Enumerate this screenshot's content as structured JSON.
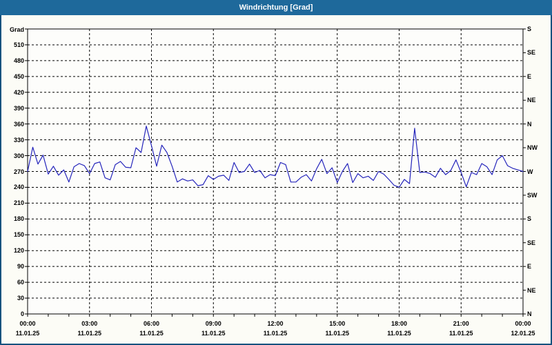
{
  "window": {
    "title": "Windrichtung [Grad]"
  },
  "colors": {
    "titlebar_bg": "#1e699b",
    "frame_border": "#16527e",
    "content_bg": "#fcfcf6",
    "plot_bg": "#fdfdfb",
    "grid": "#000000",
    "line": "#2424bb"
  },
  "chart_data": {
    "type": "line",
    "title": "Windrichtung [Grad]",
    "grid": "dashed",
    "y_axis_left": {
      "label": "Grad",
      "min": 0,
      "max": 540,
      "tick_step": 30,
      "tick_labels": [
        "0",
        "30",
        "60",
        "90",
        "120",
        "150",
        "180",
        "210",
        "240",
        "270",
        "300",
        "330",
        "360",
        "390",
        "420",
        "450",
        "480",
        "510"
      ]
    },
    "y_axis_right": {
      "tick_step": 45,
      "ticks": [
        {
          "deg": 0,
          "label": "N"
        },
        {
          "deg": 45,
          "label": "NE"
        },
        {
          "deg": 90,
          "label": "E"
        },
        {
          "deg": 135,
          "label": "SE"
        },
        {
          "deg": 180,
          "label": "S"
        },
        {
          "deg": 225,
          "label": "SW"
        },
        {
          "deg": 270,
          "label": "W"
        },
        {
          "deg": 315,
          "label": "NW"
        },
        {
          "deg": 360,
          "label": "N"
        },
        {
          "deg": 405,
          "label": "NE"
        },
        {
          "deg": 450,
          "label": "E"
        },
        {
          "deg": 495,
          "label": "SE"
        },
        {
          "deg": 540,
          "label": "S"
        }
      ]
    },
    "x_axis": {
      "minor_tick_hours": 1,
      "major_tick_hours": 3,
      "labels": [
        {
          "t": 0,
          "time": "00:00",
          "date": "11.01.25"
        },
        {
          "t": 3,
          "time": "03:00",
          "date": "11.01.25"
        },
        {
          "t": 6,
          "time": "06:00",
          "date": "11.01.25"
        },
        {
          "t": 9,
          "time": "09:00",
          "date": "11.01.25"
        },
        {
          "t": 12,
          "time": "12:00",
          "date": "11.01.25"
        },
        {
          "t": 15,
          "time": "15:00",
          "date": "11.01.25"
        },
        {
          "t": 18,
          "time": "18:00",
          "date": "11.01.25"
        },
        {
          "t": 21,
          "time": "21:00",
          "date": "11.01.25"
        },
        {
          "t": 24,
          "time": "00:00",
          "date": "12.01.25"
        }
      ]
    },
    "series": [
      {
        "name": "Windrichtung",
        "color": "#2424bb",
        "start_hour": 0,
        "interval_minutes": 15,
        "values": [
          270,
          316,
          284,
          301,
          265,
          280,
          263,
          273,
          250,
          279,
          285,
          281,
          266,
          285,
          288,
          258,
          254,
          283,
          289,
          278,
          277,
          315,
          306,
          356,
          319,
          280,
          320,
          306,
          280,
          250,
          256,
          252,
          254,
          243,
          245,
          262,
          255,
          261,
          263,
          253,
          287,
          268,
          270,
          284,
          268,
          272,
          258,
          264,
          262,
          287,
          283,
          250,
          250,
          259,
          264,
          252,
          275,
          293,
          266,
          277,
          249,
          270,
          285,
          249,
          266,
          258,
          261,
          253,
          270,
          265,
          255,
          244,
          240,
          255,
          247,
          352,
          268,
          269,
          266,
          259,
          276,
          264,
          272,
          292,
          268,
          241,
          268,
          264,
          285,
          279,
          264,
          292,
          300,
          281,
          276,
          273,
          270
        ]
      }
    ]
  }
}
